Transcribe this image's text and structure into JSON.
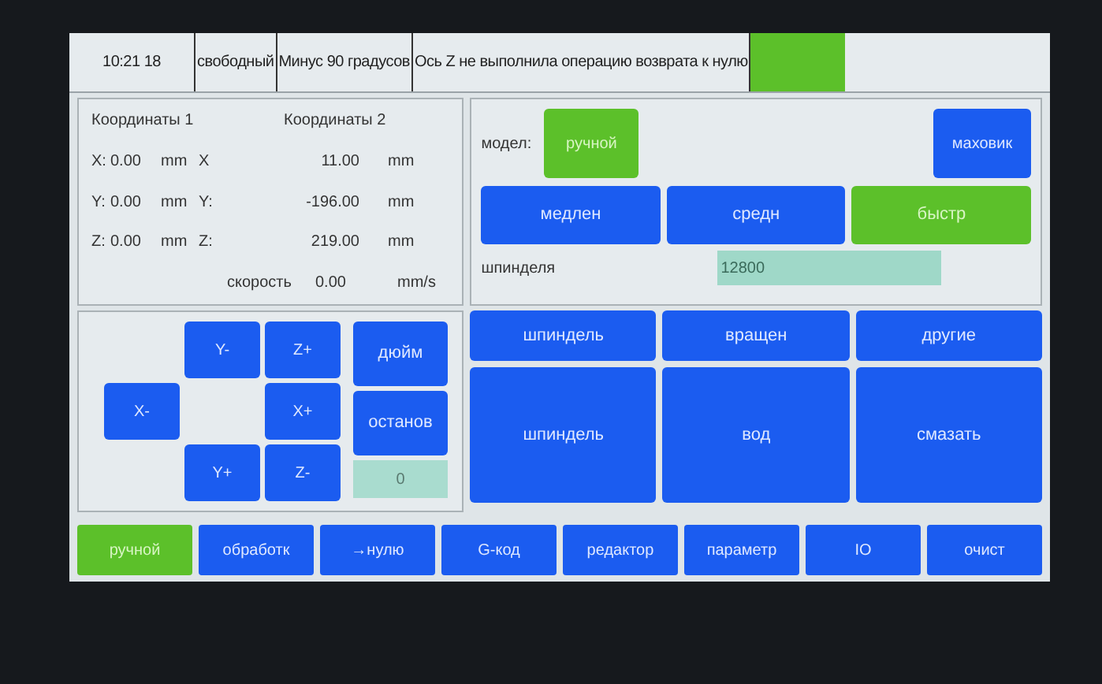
{
  "status_bar": {
    "time": "10:21 18",
    "segments": [
      "свободный",
      "Минус 90 градусов",
      "Ось Z не выполнила операцию возврата к нулю"
    ],
    "alarm_lamp": {
      "on": true
    }
  },
  "coordinates": {
    "headings": [
      "Координаты 1",
      "Координаты 2"
    ],
    "rows": [
      {
        "axis1": "X:",
        "value1": "0.00",
        "unit1": "mm",
        "axis2": "X",
        "value2": "11.00",
        "unit2": "mm"
      },
      {
        "axis1": "Y:",
        "value1": "0.00",
        "unit1": "mm",
        "axis2": "Y:",
        "value2": "-196.00",
        "unit2": "mm"
      },
      {
        "axis1": "Z:",
        "value1": "0.00",
        "unit1": "mm",
        "axis2": "Z:",
        "value2": "219.00",
        "unit2": "mm"
      }
    ],
    "speed": {
      "label": "скорость",
      "value": "0.00",
      "unit": "mm/s"
    }
  },
  "mode": {
    "label": "модел:",
    "options": [
      {
        "text": "ручной",
        "selected": true
      },
      {
        "text": "маховик",
        "selected": false
      }
    ]
  },
  "speeds": [
    {
      "text": "медлен",
      "selected": false
    },
    {
      "text": "средн",
      "selected": false
    },
    {
      "text": "быстр",
      "selected": true
    }
  ],
  "spindle": {
    "label": "шпинделя",
    "value": "12800"
  },
  "jog": [
    "Y-",
    "Z+",
    "X-",
    "X+",
    "Y+",
    "Z-"
  ],
  "jog_side": {
    "buttons": [
      "дюйм",
      "останов"
    ],
    "value": "0"
  },
  "function_tabs": [
    "шпиндель",
    "вращен",
    "другие"
  ],
  "function_buttons": [
    "шпиндель",
    "вод",
    "смазать"
  ],
  "nav": [
    {
      "text": "ручной",
      "selected": true
    },
    {
      "text": "обработк",
      "selected": false
    },
    {
      "text": "→нулю",
      "selected": false
    },
    {
      "text": "G-код",
      "selected": false
    },
    {
      "text": "редактор",
      "selected": false
    },
    {
      "text": "параметр",
      "selected": false
    },
    {
      "text": "IO",
      "selected": false
    },
    {
      "text": "очист",
      "selected": false
    }
  ]
}
